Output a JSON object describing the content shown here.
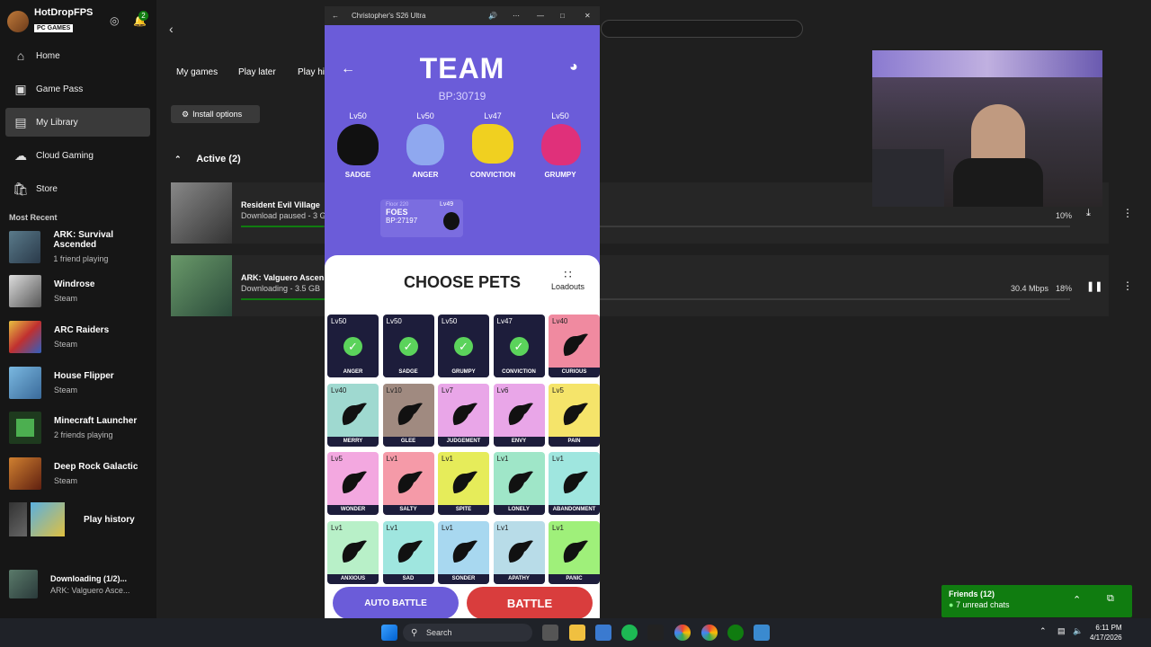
{
  "profile": {
    "name": "HotDropFPS",
    "badge": "PC GAMES",
    "notifications": "2"
  },
  "nav": [
    {
      "label": "Home"
    },
    {
      "label": "Game Pass"
    },
    {
      "label": "My Library"
    },
    {
      "label": "Cloud Gaming"
    },
    {
      "label": "Store"
    }
  ],
  "recent_heading": "Most Recent",
  "recent": [
    {
      "title": "ARK: Survival Ascended",
      "sub": "1 friend playing"
    },
    {
      "title": "Windrose",
      "sub": "Steam"
    },
    {
      "title": "ARC Raiders",
      "sub": "Steam"
    },
    {
      "title": "House Flipper",
      "sub": "Steam"
    },
    {
      "title": "Minecraft Launcher",
      "sub": "2 friends playing"
    },
    {
      "title": "Deep Rock Galactic",
      "sub": "Steam"
    }
  ],
  "play_history": "Play history",
  "downloading": {
    "title": "Downloading (1/2)...",
    "sub": "ARK: Valguero Asce..."
  },
  "tabs": [
    "My games",
    "Play later",
    "Play his"
  ],
  "install_options": "Install options",
  "active_heading": "Active (2)",
  "games": [
    {
      "title": "Resident Evil Village",
      "status": "Download paused - 3 G",
      "pct": "10%",
      "speed": "",
      "progress": 0.1
    },
    {
      "title": "ARK: Valguero Ascen",
      "status": "Downloading - 3.5 GB",
      "pct": "18%",
      "speed": "30.4 Mbps",
      "progress": 0.18
    }
  ],
  "friends": {
    "title": "Friends (12)",
    "sub": "7 unread chats"
  },
  "phone": {
    "window_title": "Christopher's S26 Ultra",
    "team_title": "TEAM",
    "team_bp": "BP:30719",
    "team_pets": [
      {
        "lv": "Lv50",
        "name": "SADGE"
      },
      {
        "lv": "Lv50",
        "name": "ANGER"
      },
      {
        "lv": "Lv47",
        "name": "CONVICTION"
      },
      {
        "lv": "Lv50",
        "name": "GRUMPY"
      }
    ],
    "foes": {
      "floor": "Floor 220",
      "label": "FOES",
      "bp": "BP:27197",
      "lv": "Lv49"
    },
    "choose_title": "CHOOSE PETS",
    "loadouts": "Loadouts",
    "cards": [
      {
        "lv": "Lv50",
        "name": "ANGER",
        "selected": true,
        "bg": "#1d1d3b"
      },
      {
        "lv": "Lv50",
        "name": "SADGE",
        "selected": true,
        "bg": "#1d1d3b"
      },
      {
        "lv": "Lv50",
        "name": "GRUMPY",
        "selected": true,
        "bg": "#1d1d3b"
      },
      {
        "lv": "Lv47",
        "name": "CONVICTION",
        "selected": true,
        "bg": "#1d1d3b"
      },
      {
        "lv": "Lv40",
        "name": "CURIOUS",
        "selected": false,
        "bg": "#f08aa0"
      },
      {
        "lv": "Lv40",
        "name": "MERRY",
        "selected": false,
        "bg": "#9fd9d0"
      },
      {
        "lv": "Lv10",
        "name": "GLEE",
        "selected": false,
        "bg": "#a08a80"
      },
      {
        "lv": "Lv7",
        "name": "JUDGEMENT",
        "selected": false,
        "bg": "#e9a6e8"
      },
      {
        "lv": "Lv6",
        "name": "ENVY",
        "selected": false,
        "bg": "#e9a6e8"
      },
      {
        "lv": "Lv5",
        "name": "PAIN",
        "selected": false,
        "bg": "#f5e46a"
      },
      {
        "lv": "Lv5",
        "name": "WONDER",
        "selected": false,
        "bg": "#f3a8e0"
      },
      {
        "lv": "Lv1",
        "name": "SALTY",
        "selected": false,
        "bg": "#f59aa8"
      },
      {
        "lv": "Lv1",
        "name": "SPITE",
        "selected": false,
        "bg": "#e6ec5a"
      },
      {
        "lv": "Lv1",
        "name": "LONELY",
        "selected": false,
        "bg": "#9fe6c8"
      },
      {
        "lv": "Lv1",
        "name": "ABANDONMENT",
        "selected": false,
        "bg": "#9fe6df"
      },
      {
        "lv": "Lv1",
        "name": "ANXIOUS",
        "selected": false,
        "bg": "#b8f0c8"
      },
      {
        "lv": "Lv1",
        "name": "SAD",
        "selected": false,
        "bg": "#9fe6df"
      },
      {
        "lv": "Lv1",
        "name": "SONDER",
        "selected": false,
        "bg": "#a8d8f0"
      },
      {
        "lv": "Lv1",
        "name": "APATHY",
        "selected": false,
        "bg": "#b8dce8"
      },
      {
        "lv": "Lv1",
        "name": "PANIC",
        "selected": false,
        "bg": "#9ff07a"
      }
    ],
    "auto_battle": "AUTO BATTLE",
    "battle": "BATTLE"
  },
  "taskbar": {
    "search": "Search",
    "time": "6:11 PM",
    "date": "4/17/2026"
  }
}
